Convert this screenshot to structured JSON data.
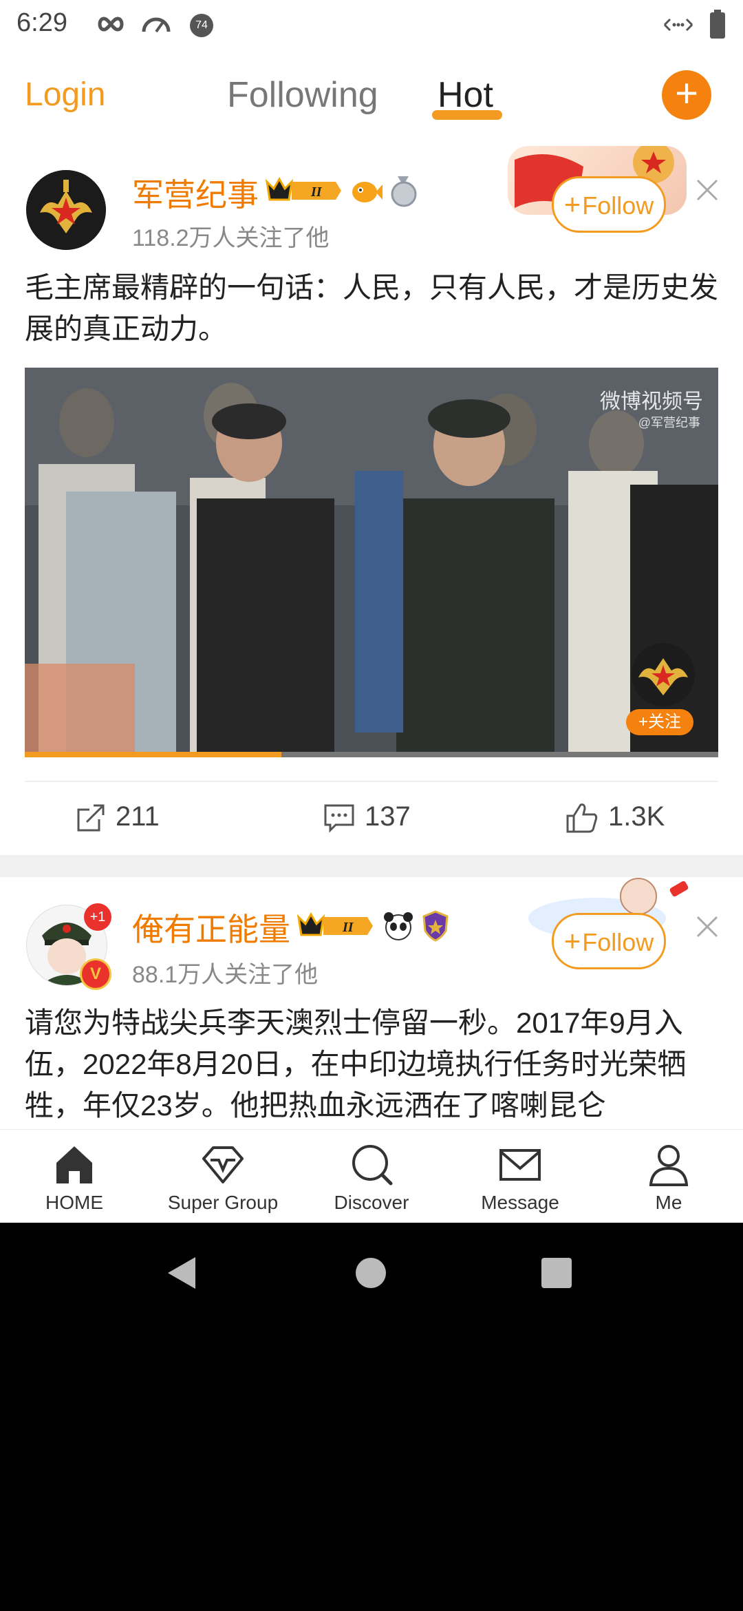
{
  "status_bar": {
    "time": "6:29",
    "icons": [
      "infinity-icon",
      "speedometer-icon",
      "notification-74-icon",
      "data-arrows-icon",
      "battery-icon"
    ],
    "badge_number": "74"
  },
  "top_nav": {
    "login": "Login",
    "tabs": [
      {
        "label": "Following"
      },
      {
        "label": "Hot",
        "active": true
      }
    ],
    "add_icon": "plus-icon"
  },
  "posts": [
    {
      "name": "军营纪事",
      "fans": "118.2万人关注了他",
      "badge_level": "II",
      "follow_label": "Follow",
      "text": "毛主席最精辟的一句话：人民，只有人民，才是历史发展的真正动力。",
      "video": {
        "watermark": "微博视频号",
        "watermark_sub": "@军营纪事",
        "follow_chip": "+关注",
        "progress": 0.37
      },
      "actions": {
        "repost": "211",
        "comment": "137",
        "like": "1.3K"
      }
    },
    {
      "name": "俺有正能量",
      "fans": "88.1万人关注了他",
      "badge_level": "II",
      "avatar_badge": "+1",
      "follow_label": "Follow",
      "text": "请您为特战尖兵李天澳烈士停留一秒。2017年9月入伍，2022年8月20日，在中印边境执行任务时光荣牺牲，年仅23岁。他把热血永远洒在了喀喇昆仑"
    }
  ],
  "bottom_nav": [
    {
      "label": "HOME",
      "icon": "home-icon"
    },
    {
      "label": "Super Group",
      "icon": "diamond-icon"
    },
    {
      "label": "Discover",
      "icon": "search-icon"
    },
    {
      "label": "Message",
      "icon": "envelope-icon"
    },
    {
      "label": "Me",
      "icon": "person-icon"
    }
  ],
  "colors": {
    "accent": "#f39b20",
    "name": "#ef7c00",
    "progress": "#f39b20"
  }
}
